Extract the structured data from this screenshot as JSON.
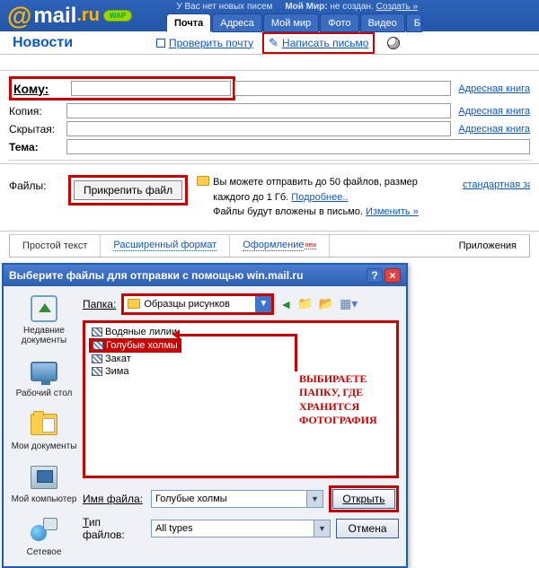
{
  "header": {
    "logo_at": "@",
    "logo_mail": "mail",
    "logo_ru": ".ru",
    "wap": "WAP",
    "no_new": "У Вас нет новых писем",
    "my_world_lbl": "Мой Мир:",
    "not_created": "не создан.",
    "create": "Создать »"
  },
  "tabs": {
    "mail": "Почта",
    "addresses": "Адреса",
    "myworld": "Мой мир",
    "photo": "Фото",
    "video": "Видео",
    "more": "Б"
  },
  "subbar": {
    "news": "Новости",
    "check": "Проверить почту",
    "compose": "Написать письмо"
  },
  "form": {
    "to": "Кому:",
    "copy": "Копия:",
    "hidden": "Скрытая:",
    "subject": "Тема:",
    "address_book": "Адресная книга",
    "files": "Файлы:",
    "attach": "Прикрепить файл",
    "info1": "Вы можете отправить до 50 файлов, размер каждого до 1 Гб. ",
    "info_more": "Подробнее..",
    "info2": "Файлы будут вложены в письмо. ",
    "info_change": "Изменить »",
    "std": "стандартная заг"
  },
  "editor": {
    "plain": "Простой текст",
    "rich": "Расширенный формат",
    "design": "Оформление",
    "new": "new",
    "attachments": "Приложения"
  },
  "dialog": {
    "title": "Выберите файлы для отправки с помощью win.mail.ru",
    "folder_lbl": "Папка:",
    "folder_val": "Образцы рисунков",
    "files": [
      "Водяные лилии",
      "Голубые холмы",
      "Закат",
      "Зима"
    ],
    "selected_idx": 1,
    "annotation_l1": "ВЫБИРАЕТЕ",
    "annotation_l2": "ПАПКУ, ГДЕ",
    "annotation_l3": "ХРАНИТСЯ",
    "annotation_l4": "ФОТОГРАФИЯ",
    "filename_lbl": "Имя файла:",
    "filename_val": "Голубые холмы",
    "filetype_lbl": "Тип файлов:",
    "filetype_val": "All types",
    "open": "Открыть",
    "cancel": "Отмена",
    "side": {
      "recent": "Недавние документы",
      "desktop": "Рабочий стол",
      "mydocs": "Мои документы",
      "mypc": "Мой компьютер",
      "network": "Сетевое"
    }
  }
}
